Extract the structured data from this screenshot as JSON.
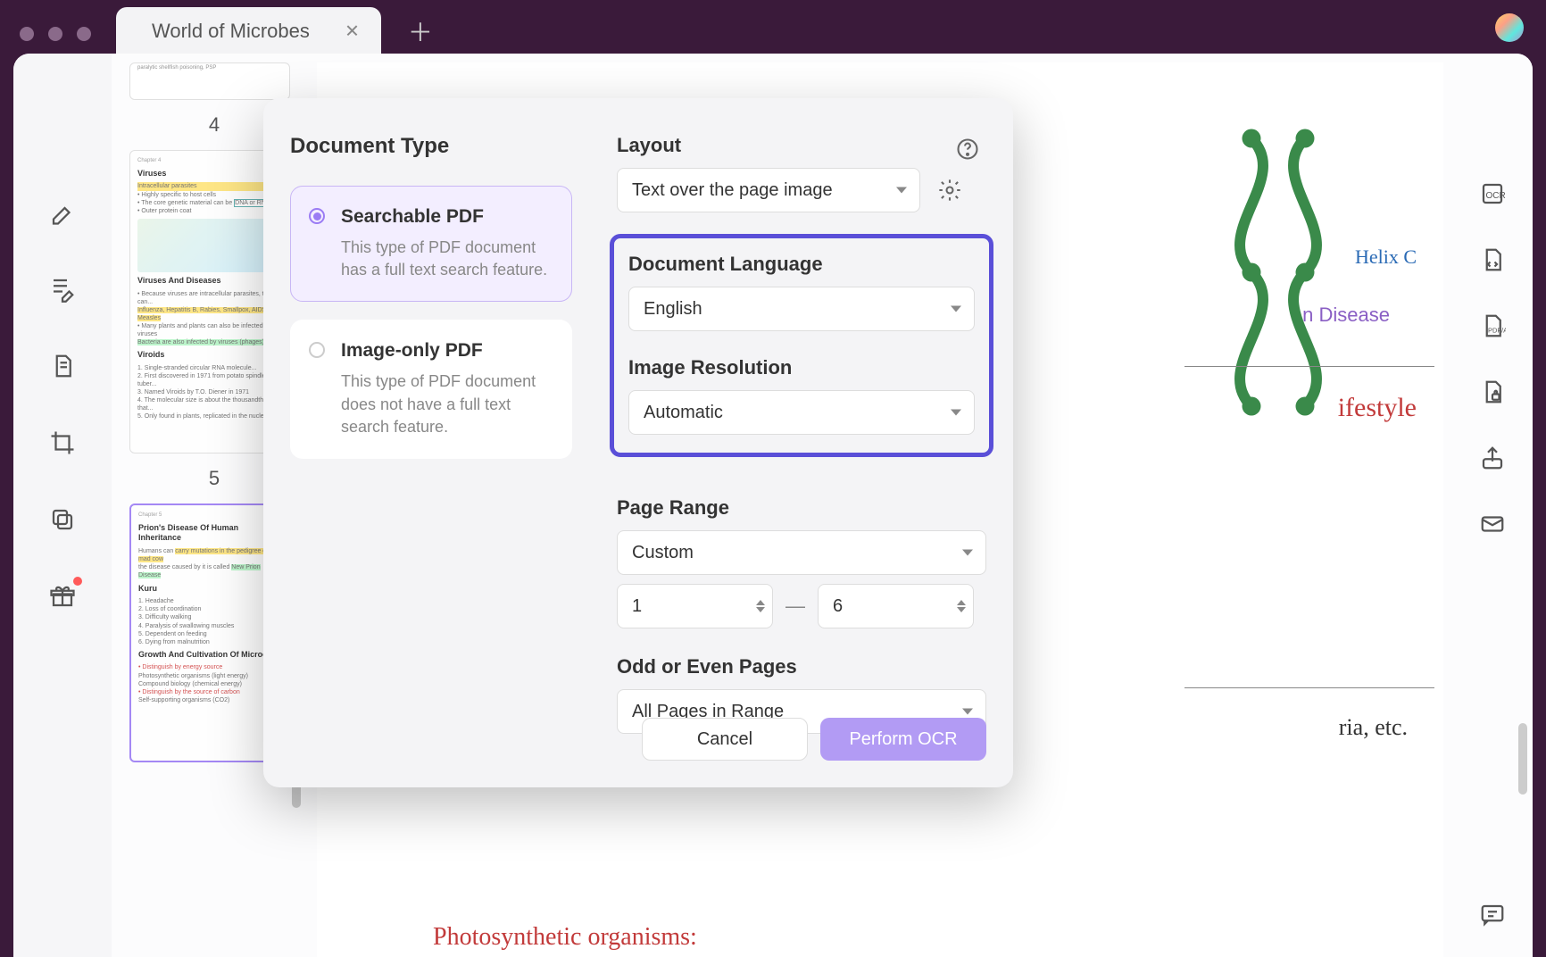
{
  "tab": {
    "title": "World of Microbes"
  },
  "thumbnails": {
    "page4_label": "4",
    "page5_label": "5",
    "t4": {
      "h1": "Viruses",
      "h2": "Viruses And Diseases",
      "h3": "Viroids"
    },
    "t5": {
      "h1": "Prion's Disease Of Human Inheritance",
      "h2": "Kuru",
      "h3": "Growth And Cultivation Of Microorg"
    }
  },
  "doc": {
    "helix_label": "Helix C",
    "disease_text": "n Disease",
    "lifestyle_text": "ifestyle",
    "ria_text": "ria, etc.",
    "photo_text": "Photosynthetic organisms:"
  },
  "dialog": {
    "document_type_label": "Document Type",
    "searchable": {
      "title": "Searchable PDF",
      "desc": "This type of PDF document has a full text search feature."
    },
    "image_only": {
      "title": "Image-only PDF",
      "desc": "This type of PDF document does not have a full text search feature."
    },
    "layout_label": "Layout",
    "layout_value": "Text over the page image",
    "lang_label": "Document Language",
    "lang_value": "English",
    "res_label": "Image Resolution",
    "res_value": "Automatic",
    "range_label": "Page Range",
    "range_value": "Custom",
    "range_from": "1",
    "range_to": "6",
    "odd_even_label": "Odd or Even Pages",
    "odd_even_value": "All Pages in Range",
    "cancel": "Cancel",
    "perform": "Perform OCR"
  }
}
